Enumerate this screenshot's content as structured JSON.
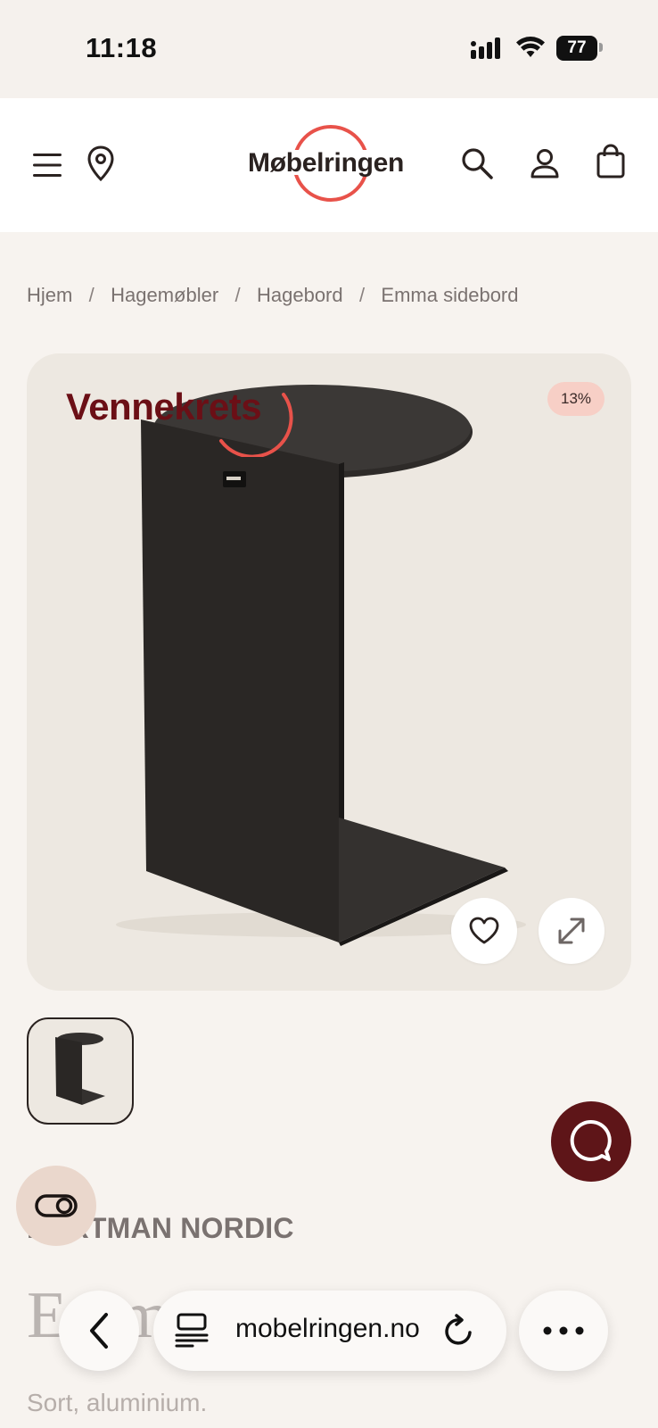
{
  "status_bar": {
    "time": "11:18",
    "battery": "77"
  },
  "header": {
    "logo_text": "Møbelringen",
    "brand_color": "#e8524a"
  },
  "breadcrumb": {
    "items": [
      "Hjem",
      "Hagemøbler",
      "Hagebord",
      "Emma sidebord"
    ],
    "separator": "/"
  },
  "product_image": {
    "badge": "Vennekrets",
    "discount": "13%"
  },
  "product": {
    "brand": "HARTMAN NORDIC",
    "title": "Emma sidebord",
    "subtitle": "Sort, aluminium."
  },
  "browser_bar": {
    "url": "mobelringen.no"
  },
  "colors": {
    "accent_dark": "#5e1518",
    "badge_bg": "#f7cfc6",
    "page_bg": "#f7f3ef"
  }
}
